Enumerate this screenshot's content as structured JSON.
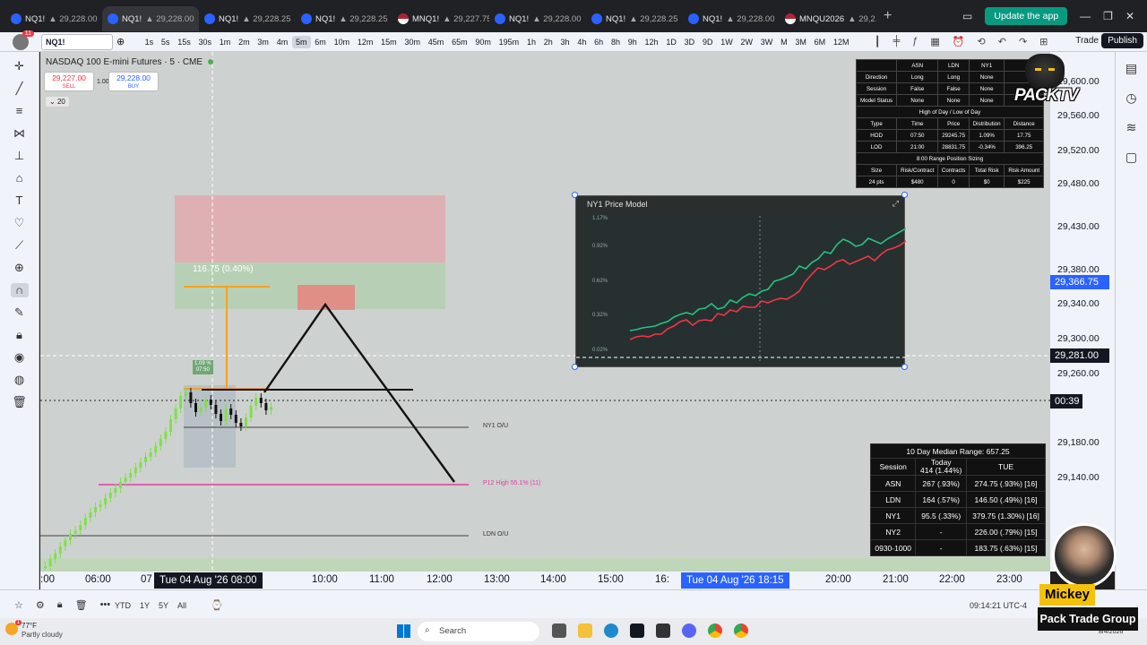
{
  "browser": {
    "tabs": [
      {
        "label": "NQ1!",
        "price": "29,228.00",
        "active": false
      },
      {
        "label": "NQ1!",
        "price": "29,228.00",
        "active": true
      },
      {
        "label": "NQ1!",
        "price": "29,228.25",
        "active": false
      },
      {
        "label": "NQ1!",
        "price": "29,228.25",
        "active": false
      },
      {
        "label": "MNQ1!",
        "price": "29,227.75",
        "active": false
      },
      {
        "label": "NQ1!",
        "price": "29,228.00",
        "active": false
      },
      {
        "label": "NQ1!",
        "price": "29,228.25",
        "active": false
      },
      {
        "label": "NQ1!",
        "price": "29,228.00",
        "active": false
      },
      {
        "label": "MNQU2026",
        "price": "29,2...",
        "active": false
      }
    ],
    "update_label": "Update the app"
  },
  "toolbar": {
    "symbol": "NQ1!",
    "notification_count": "11",
    "intervals": [
      "1s",
      "5s",
      "15s",
      "30s",
      "1m",
      "2m",
      "3m",
      "4m",
      "5m",
      "6m",
      "10m",
      "12m",
      "15m",
      "30m",
      "45m",
      "65m",
      "90m",
      "195m",
      "1h",
      "2h",
      "3h",
      "4h",
      "6h",
      "8h",
      "9h",
      "12h",
      "1D",
      "3D",
      "9D",
      "1W",
      "2W",
      "3W",
      "M",
      "3M",
      "6M",
      "12M"
    ],
    "selected_interval": "5m",
    "trade_label": "Trade",
    "publish_label": "Publish"
  },
  "chart": {
    "title": "NASDAQ 100 E-mini Futures · 5 · CME",
    "sell_price": "29,227.00",
    "sell_label": "SELL",
    "buy_price": "29,228.00",
    "buy_label": "BUY",
    "quantity": "1.00",
    "indicator_count": "20",
    "range_label": "116.75 (0.40%)",
    "ny1_open_label": "1.09 %",
    "ny1_open_time": "07:50",
    "ny1_ou_label": "NY1 O/U",
    "ldn_ou_label": "LDN O/U",
    "pdh_label": "P12 High 55.1% (11)"
  },
  "stats_table": {
    "header": [
      "",
      "ASN",
      "LDN",
      "NY1"
    ],
    "rows": [
      [
        "Direction",
        "Long",
        "Long",
        "None"
      ],
      [
        "Session",
        "False",
        "False",
        "None"
      ],
      [
        "Model Status",
        "None",
        "None",
        "None"
      ]
    ],
    "section1": "High of Day / Low of Day",
    "hodlod_header": [
      "Type",
      "Time",
      "Price",
      "Distribution",
      "Distance"
    ],
    "hodlod_rows": [
      [
        "HOD",
        "07:50",
        "29245.75",
        "1.09%",
        "17.75"
      ],
      [
        "LOD",
        "21:00",
        "28831.75",
        "-0.34%",
        "396.25"
      ]
    ],
    "section2": "8:00 Range Position Sizing",
    "sizing_header": [
      "Size",
      "Risk/Contract",
      "Contracts",
      "Total Risk",
      "Risk Amount"
    ],
    "sizing_row": [
      "24 pts",
      "$480",
      "0",
      "$0",
      "$225"
    ]
  },
  "ny1_model": {
    "title": "NY1 Price Model",
    "y_labels": [
      "1.17%",
      "0.92%",
      "0.62%",
      "0.32%",
      "0.02%"
    ]
  },
  "range_table": {
    "title": "10 Day Median Range: 657.25",
    "header": [
      "Session",
      "Today",
      "TUE"
    ],
    "today_sub": "414 (1.44%)",
    "rows": [
      [
        "ASN",
        "267 (.93%)",
        "274.75 (.93%) [16]"
      ],
      [
        "LDN",
        "164 (.57%)",
        "146.50 (.49%) [16]"
      ],
      [
        "NY1",
        "95.5 (.33%)",
        "379.75 (1.30%) [16]"
      ],
      [
        "NY2",
        "-",
        "226.00 (.79%) [15]"
      ],
      [
        "0930-1000",
        "-",
        "183.75 (.63%) [15]"
      ]
    ]
  },
  "price_scale": {
    "ticks": [
      "29,600.00",
      "29,560.00",
      "29,520.00",
      "29,480.00",
      "29,430.00",
      "29,380.00",
      "29,340.00",
      "29,300.00",
      "29,260.00",
      "29,180.00",
      "29,140.00"
    ],
    "alert_price": "29,366.75",
    "crosshair_price": "29,281.00",
    "countdown": "00:39"
  },
  "time_scale": {
    "ticks": [
      ":00",
      "06:00",
      "07",
      "10:00",
      "11:00",
      "12:00",
      "13:00",
      "14:00",
      "15:00",
      "16:",
      "20:00",
      "21:00",
      "22:00",
      "23:00"
    ],
    "crosshair_time": "Tue 04 Aug '26   08:00",
    "hover_time": "Tue 04 Aug '26   18:15"
  },
  "bottom_bar": {
    "ranges": [
      "YTD",
      "1Y",
      "5Y",
      "All"
    ],
    "clock": "09:14:21 UTC-4"
  },
  "taskbar": {
    "temp": "77°F",
    "weather": "Partly cloudy",
    "weather_badge": "1",
    "search_placeholder": "Search",
    "date": "8/4/2026"
  },
  "overlay": {
    "brand": "PACKTV",
    "name": "Mickey",
    "group": "Pack Trade Group"
  },
  "colors": {
    "accent": "#2962ff",
    "bull": "#7fe04a",
    "bear": "#111111",
    "alert": "#2962ff",
    "magenta": "#e040a0",
    "orange": "#f7a21b"
  }
}
